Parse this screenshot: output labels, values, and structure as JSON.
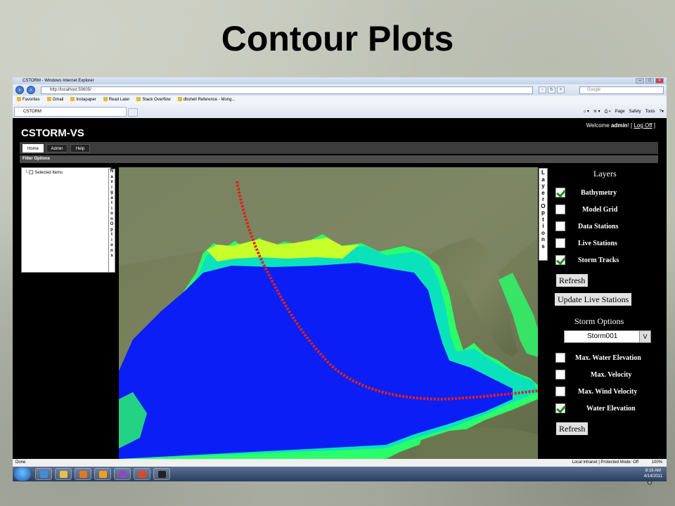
{
  "slide": {
    "title": "Contour Plots",
    "page_number": "6"
  },
  "browser": {
    "window_title": "CSTORM - Windows Internet Explorer",
    "url": "http://localhost:50605/",
    "search_placeholder": "Google",
    "favorites": [
      "Favorites",
      "Gmail",
      "Instapaper",
      "Read Later",
      "Stack Overflow",
      "dbshell Reference - Mong..."
    ],
    "tab_label": "CSTORM",
    "command_items": [
      "Page",
      "Safety",
      "Tools"
    ],
    "status_left": "Done",
    "status_zone": "Local intranet | Protected Mode: Off",
    "zoom": "100%"
  },
  "app": {
    "title": "CSTORM-VS",
    "welcome_prefix": "Welcome ",
    "user": "admin",
    "welcome_suffix": "! [ ",
    "logoff": "Log Off",
    "welcome_end": " ]",
    "menu": [
      "Home",
      "Admin",
      "Help"
    ],
    "filter_label": "Filter Options",
    "tree_item": "Selected Items",
    "nav_strip": "Navigation Options",
    "layer_strip": "Layer Options"
  },
  "layers": {
    "title": "Layers",
    "items": [
      {
        "label": "Bathymetry",
        "checked": true
      },
      {
        "label": "Model Grid",
        "checked": false
      },
      {
        "label": "Data Stations",
        "checked": false
      },
      {
        "label": "Live Stations",
        "checked": false
      },
      {
        "label": "Storm Tracks",
        "checked": true
      }
    ],
    "refresh_label": "Refresh",
    "update_label": "Update Live Stations"
  },
  "storm": {
    "title": "Storm Options",
    "selected": "Storm001",
    "arrow": "V",
    "items": [
      {
        "label": "Max. Water Elevation",
        "checked": false
      },
      {
        "label": "Max. Velocity",
        "checked": false
      },
      {
        "label": "Max. Wind Velocity",
        "checked": false
      },
      {
        "label": "Water Elevation",
        "checked": true
      }
    ],
    "refresh_label": "Refresh"
  },
  "taskbar": {
    "time": "8:16 AM",
    "date": "4/14/2011"
  }
}
